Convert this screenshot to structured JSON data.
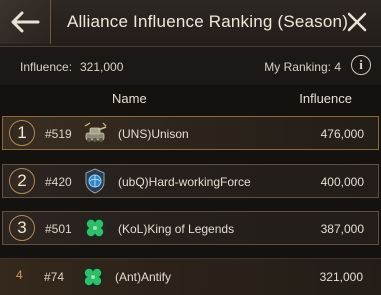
{
  "header": {
    "title": "Alliance Influence Ranking (Season)",
    "back_icon": "back-arrow-icon",
    "close_icon": "close-icon"
  },
  "summary": {
    "influence_label": "Influence:",
    "influence_value": "321,000",
    "my_ranking": "My Ranking: 4",
    "info_icon": "info-icon",
    "info_glyph": "i"
  },
  "columns": {
    "name": "Name",
    "influence": "Influence"
  },
  "rows": [
    {
      "rank": "1",
      "server": "#519",
      "alliance": "(UNS)Unison",
      "influence": "476,000",
      "emblem": "tank-emblem-icon"
    },
    {
      "rank": "2",
      "server": "#420",
      "alliance": "(ubQ)Hard-workingForce",
      "influence": "400,000",
      "emblem": "blue-globe-emblem-icon"
    },
    {
      "rank": "3",
      "server": "#501",
      "alliance": "(KoL)King of Legends",
      "influence": "387,000",
      "emblem": "clover-emblem-icon"
    },
    {
      "rank": "4",
      "server": "#74",
      "alliance": "(Ant)Antify",
      "influence": "321,000",
      "emblem": "clover-emblem-icon"
    }
  ],
  "colors": {
    "accent_gold": "#b08a54",
    "rank4_orange": "#d19a5a",
    "background": "#14110f"
  }
}
